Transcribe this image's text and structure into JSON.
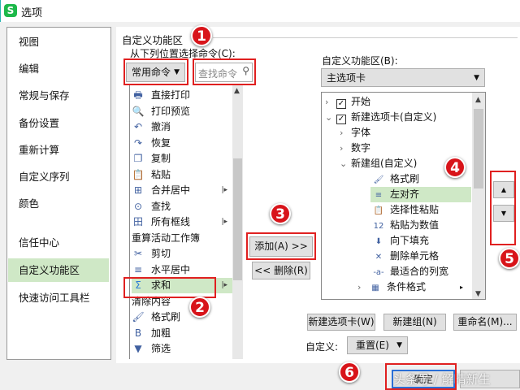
{
  "window": {
    "title": "选项",
    "logo": "S"
  },
  "nav": [
    "视图",
    "编辑",
    "常规与保存",
    "备份设置",
    "重新计算",
    "自定义序列",
    "颜色",
    "信任中心",
    "自定义功能区",
    "快速访问工具栏"
  ],
  "left": {
    "group_label": "自定义功能区",
    "choose_label": "从下列位置选择命令(C):",
    "source_select": "常用命令",
    "search_placeholder": "查找命令",
    "commands": [
      {
        "label": "直接打印",
        "icon": "print-icon",
        "glyph": "🖶"
      },
      {
        "label": "打印预览",
        "icon": "print-preview-icon",
        "glyph": "🔍"
      },
      {
        "label": "撤消",
        "icon": "undo-icon",
        "glyph": "↶"
      },
      {
        "label": "恢复",
        "icon": "redo-icon",
        "glyph": "↷"
      },
      {
        "label": "复制",
        "icon": "copy-icon",
        "glyph": "❐"
      },
      {
        "label": "粘贴",
        "icon": "paste-icon",
        "glyph": "📋"
      },
      {
        "label": "合并居中",
        "icon": "merge-center-icon",
        "glyph": "⊞",
        "sub": true
      },
      {
        "label": "查找",
        "icon": "find-icon",
        "glyph": "⊙"
      },
      {
        "label": "所有框线",
        "icon": "borders-icon",
        "glyph": "田",
        "sub": true
      },
      {
        "label": "重算活动工作簿",
        "icon": "",
        "glyph": ""
      },
      {
        "label": "剪切",
        "icon": "cut-icon",
        "glyph": "✂"
      },
      {
        "label": "水平居中",
        "icon": "align-center-icon",
        "glyph": "≡"
      },
      {
        "label": "求和",
        "icon": "sum-icon",
        "glyph": "Σ",
        "sub": true,
        "selected": true
      },
      {
        "label": "清除内容",
        "icon": "",
        "glyph": ""
      },
      {
        "label": "格式刷",
        "icon": "format-painter-icon",
        "glyph": "🖌"
      },
      {
        "label": "加粗",
        "icon": "bold-icon",
        "glyph": "B"
      },
      {
        "label": "筛选",
        "icon": "filter-icon",
        "glyph": "▼"
      }
    ]
  },
  "middle": {
    "add": "添加(A) >>",
    "remove": "<< 删除(R)"
  },
  "right": {
    "label": "自定义功能区(B):",
    "tab_select": "主选项卡",
    "tree": [
      {
        "label": "开始",
        "level": 0,
        "exp": ">",
        "check": true
      },
      {
        "label": "新建选项卡(自定义)",
        "level": 0,
        "exp": "v",
        "check": true
      },
      {
        "label": "字体",
        "level": 1,
        "exp": ">"
      },
      {
        "label": "数字",
        "level": 1,
        "exp": ">"
      },
      {
        "label": "新建组(自定义)",
        "level": 1,
        "exp": "v"
      },
      {
        "label": "格式刷",
        "level": 2,
        "glyph": "🖌",
        "icon": "format-painter-icon"
      },
      {
        "label": "左对齐",
        "level": 2,
        "glyph": "≡",
        "icon": "align-left-icon",
        "selected": true
      },
      {
        "label": "选择性粘贴",
        "level": 2,
        "glyph": "📋",
        "icon": "paste-special-icon"
      },
      {
        "label": "粘贴为数值",
        "level": 2,
        "glyph": "12",
        "icon": "paste-values-icon"
      },
      {
        "label": "向下填充",
        "level": 2,
        "glyph": "⬇",
        "icon": "fill-down-icon"
      },
      {
        "label": "删除单元格",
        "level": 2,
        "glyph": "✕",
        "icon": "delete-cells-icon"
      },
      {
        "label": "最适合的列宽",
        "level": 2,
        "glyph": "-a-",
        "icon": "autofit-icon"
      },
      {
        "label": "条件格式",
        "level": 2,
        "glyph": "▦",
        "icon": "conditional-format-icon",
        "exp": ">",
        "sub": true
      }
    ],
    "new_tab": "新建选项卡(W)",
    "new_group": "新建组(N)",
    "rename": "重命名(M)...",
    "custom_label": "自定义:",
    "reset": "重置(E)",
    "up": "▲",
    "down": "▼"
  },
  "footer": {
    "ok": "确定",
    "watermark": "头条号 / 解晴新生"
  },
  "markers": [
    "1",
    "2",
    "3",
    "4",
    "5",
    "6"
  ]
}
